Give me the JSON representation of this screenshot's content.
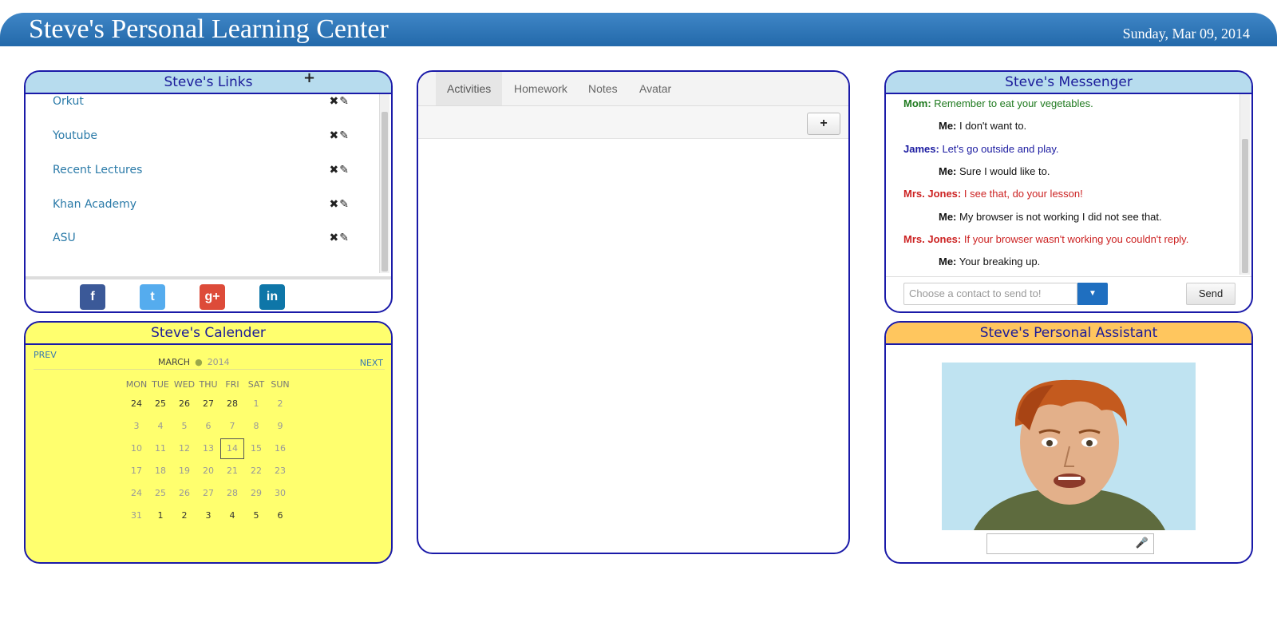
{
  "header": {
    "title": "Steve's Personal Learning Center",
    "date": "Sunday, Mar 09, 2014"
  },
  "links": {
    "title": "Steve's Links",
    "add_icon": "plus-icon",
    "items": [
      {
        "label": "Orkut"
      },
      {
        "label": "Youtube"
      },
      {
        "label": "Recent Lectures"
      },
      {
        "label": "Khan Academy"
      },
      {
        "label": "ASU"
      }
    ],
    "action_icons": [
      "delete-icon",
      "edit-icon"
    ],
    "social": [
      {
        "icon": "facebook-icon",
        "glyph": "f",
        "color": "#3b5998"
      },
      {
        "icon": "twitter-icon",
        "glyph": "t",
        "color": "#55acee"
      },
      {
        "icon": "google-plus-icon",
        "glyph": "g+",
        "color": "#dd4b39"
      },
      {
        "icon": "linkedin-icon",
        "glyph": "in",
        "color": "#0e76a8"
      }
    ]
  },
  "calendar": {
    "title": "Steve's Calender",
    "prev": "PREV",
    "next": "NEXT",
    "month": "MARCH",
    "year": "2014",
    "days": [
      "MON",
      "TUE",
      "WED",
      "THU",
      "FRI",
      "SAT",
      "SUN"
    ],
    "weeks": [
      [
        24,
        25,
        26,
        27,
        28,
        1,
        2
      ],
      [
        3,
        4,
        5,
        6,
        7,
        8,
        9
      ],
      [
        10,
        11,
        12,
        13,
        14,
        15,
        16
      ],
      [
        17,
        18,
        19,
        20,
        21,
        22,
        23
      ],
      [
        24,
        25,
        26,
        27,
        28,
        29,
        30
      ],
      [
        31,
        1,
        2,
        3,
        4,
        5,
        6
      ]
    ],
    "highlight": 14
  },
  "activities": {
    "tabs": [
      {
        "label": "Activities",
        "active": true
      },
      {
        "label": "Homework"
      },
      {
        "label": "Notes"
      },
      {
        "label": "Avatar"
      }
    ],
    "add_label": "+"
  },
  "messenger": {
    "title": "Steve's Messenger",
    "messages": [
      {
        "from": "Mom:",
        "text": "Remember to eat your vegetables.",
        "color": "#1f7a1f",
        "indent": false
      },
      {
        "from": "Me:",
        "text": "I don't want to.",
        "color": "#111111",
        "indent": true
      },
      {
        "from": "James:",
        "text": "Let's go outside and play.",
        "color": "#1a1aa0",
        "indent": false
      },
      {
        "from": "Me:",
        "text": "Sure I would like to.",
        "color": "#111111",
        "indent": true
      },
      {
        "from": "Mrs. Jones:",
        "text": "I see that, do your lesson!",
        "color": "#cc2222",
        "indent": false
      },
      {
        "from": "Me:",
        "text": "My browser is not working I did not see that.",
        "color": "#111111",
        "indent": true
      },
      {
        "from": "Mrs. Jones:",
        "text": "If your browser wasn't working you couldn't reply.",
        "color": "#cc2222",
        "indent": false
      },
      {
        "from": "Me:",
        "text": "Your breaking up.",
        "color": "#111111",
        "indent": true
      }
    ],
    "contact_placeholder": "Choose a contact to send to!",
    "send_label": "Send"
  },
  "assistant": {
    "title": "Steve's Personal Assistant",
    "mic_icon": "microphone-icon"
  },
  "colors": {
    "header": "#2369aa",
    "panel_border": "#1a1aa8",
    "links_head": "#b7dcee",
    "calendar_bg": "#ffff6e",
    "assistant_head": "#ffc65e"
  }
}
